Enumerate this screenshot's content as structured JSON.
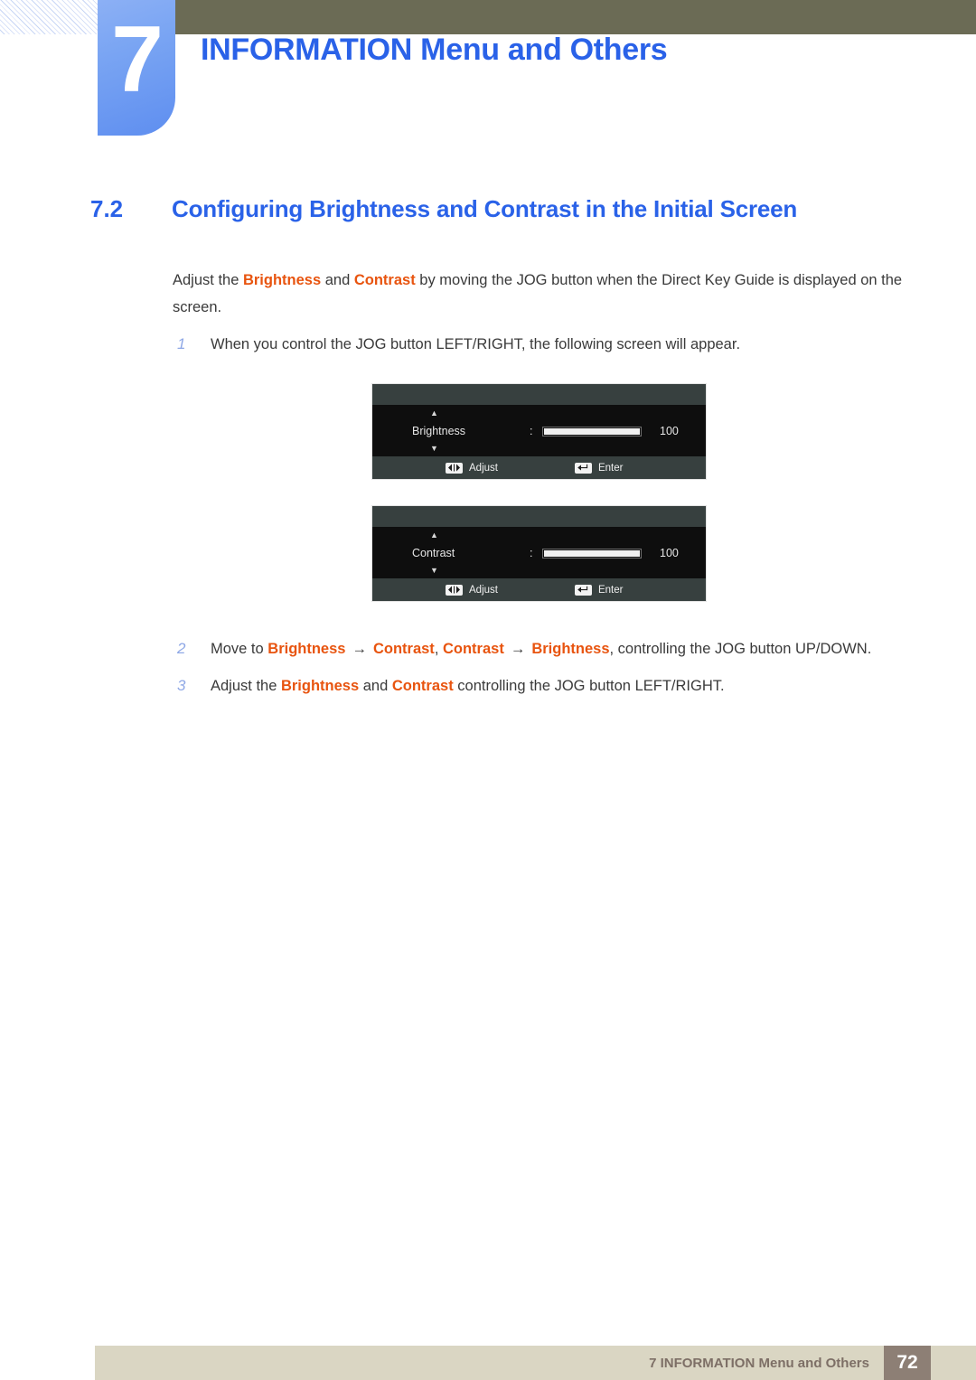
{
  "header": {
    "chapter_number": "7",
    "chapter_title": "INFORMATION Menu and Others",
    "accent_blue": "#2a62e8",
    "badge_blue": "#7aa5f3",
    "olive": "#6b6b55"
  },
  "section": {
    "number": "7.2",
    "title": "Configuring Brightness and Contrast in the Initial Screen"
  },
  "intro": {
    "part1": "Adjust the ",
    "kw1": "Brightness",
    "part2": " and ",
    "kw2": "Contrast",
    "part3": " by moving the JOG button when the Direct Key Guide is displayed on the screen."
  },
  "steps": [
    {
      "number": "1",
      "text": "When you control the JOG button LEFT/RIGHT, the following screen will appear."
    },
    {
      "number": "2",
      "lead": "Move to ",
      "kw1": "Brightness",
      "arrow1": "→",
      "kw2": "Contrast",
      "sep": ", ",
      "kw3": "Contrast",
      "arrow2": "→",
      "kw4": "Brightness",
      "tail": ", controlling the JOG button UP/DOWN."
    },
    {
      "number": "3",
      "lead": "Adjust the ",
      "kw1": "Brightness",
      "mid": " and ",
      "kw2": "Contrast",
      "tail": " controlling the JOG button LEFT/RIGHT."
    }
  ],
  "osd_screens": [
    {
      "caret_up": "▲",
      "caret_down": "▼",
      "label": "Brightness",
      "colon": ":",
      "value": "100",
      "slider_percent": 100,
      "hint_adjust": "Adjust",
      "hint_enter": "Enter",
      "adjust_icon": "left-right-arrow-key-icon",
      "enter_icon": "enter-return-key-icon"
    },
    {
      "caret_up": "▲",
      "caret_down": "▼",
      "label": "Contrast",
      "colon": ":",
      "value": "100",
      "slider_percent": 100,
      "hint_adjust": "Adjust",
      "hint_enter": "Enter",
      "adjust_icon": "left-right-arrow-key-icon",
      "enter_icon": "enter-return-key-icon"
    }
  ],
  "footer": {
    "text": "7 INFORMATION Menu and Others",
    "page_number": "72",
    "bar_color": "#dad6c3",
    "page_box_color": "#8d7f75"
  }
}
